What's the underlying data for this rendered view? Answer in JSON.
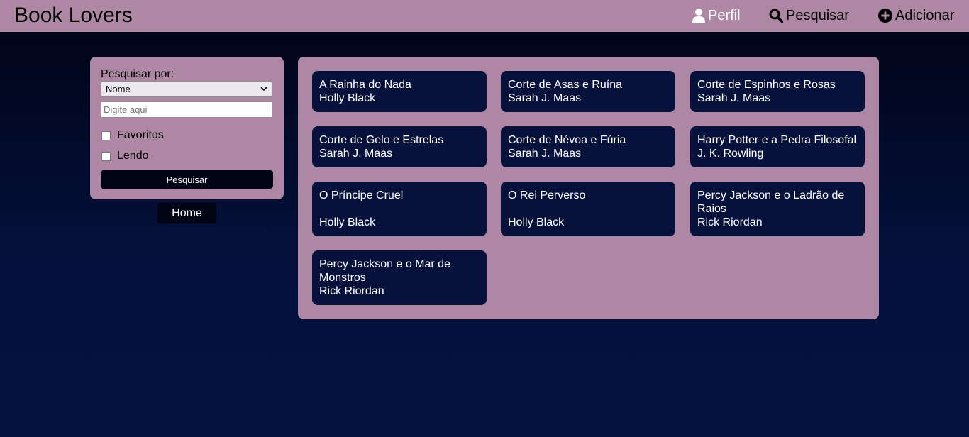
{
  "header": {
    "brand": "Book Lovers",
    "nav": {
      "perfil": "Perfil",
      "pesquisar": "Pesquisar",
      "adicionar": "Adicionar"
    }
  },
  "search": {
    "label": "Pesquisar por:",
    "select_value": "Nome",
    "input_placeholder": "Digite aqui",
    "input_value": "",
    "favoritos_label": "Favoritos",
    "lendo_label": "Lendo",
    "favoritos_checked": false,
    "lendo_checked": false,
    "button_label": "Pesquisar"
  },
  "home_button": "Home",
  "books": [
    {
      "title": "A Rainha do Nada",
      "author": "Holly Black"
    },
    {
      "title": "Corte de Asas e Ruína",
      "author": "Sarah J. Maas"
    },
    {
      "title": "Corte de Espinhos e Rosas",
      "author": "Sarah J. Maas"
    },
    {
      "title": "Corte de Gelo e Estrelas",
      "author": "Sarah J. Maas"
    },
    {
      "title": "Corte de Névoa e Fúria",
      "author": "Sarah J. Maas"
    },
    {
      "title": "Harry Potter e a Pedra Filosofal",
      "author": "J. K. Rowling"
    },
    {
      "title": "O Príncipe Cruel",
      "author": "Holly Black"
    },
    {
      "title": "O Rei Perverso",
      "author": "Holly Black"
    },
    {
      "title": "Percy Jackson e o Ladrão de Raios",
      "author": "Rick Riordan"
    },
    {
      "title": "Percy Jackson e o Mar de Monstros",
      "author": "Rick Riordan"
    }
  ],
  "colors": {
    "header_bg": "#ad87a3",
    "card_bg": "#07123c",
    "button_bg": "#000314"
  }
}
